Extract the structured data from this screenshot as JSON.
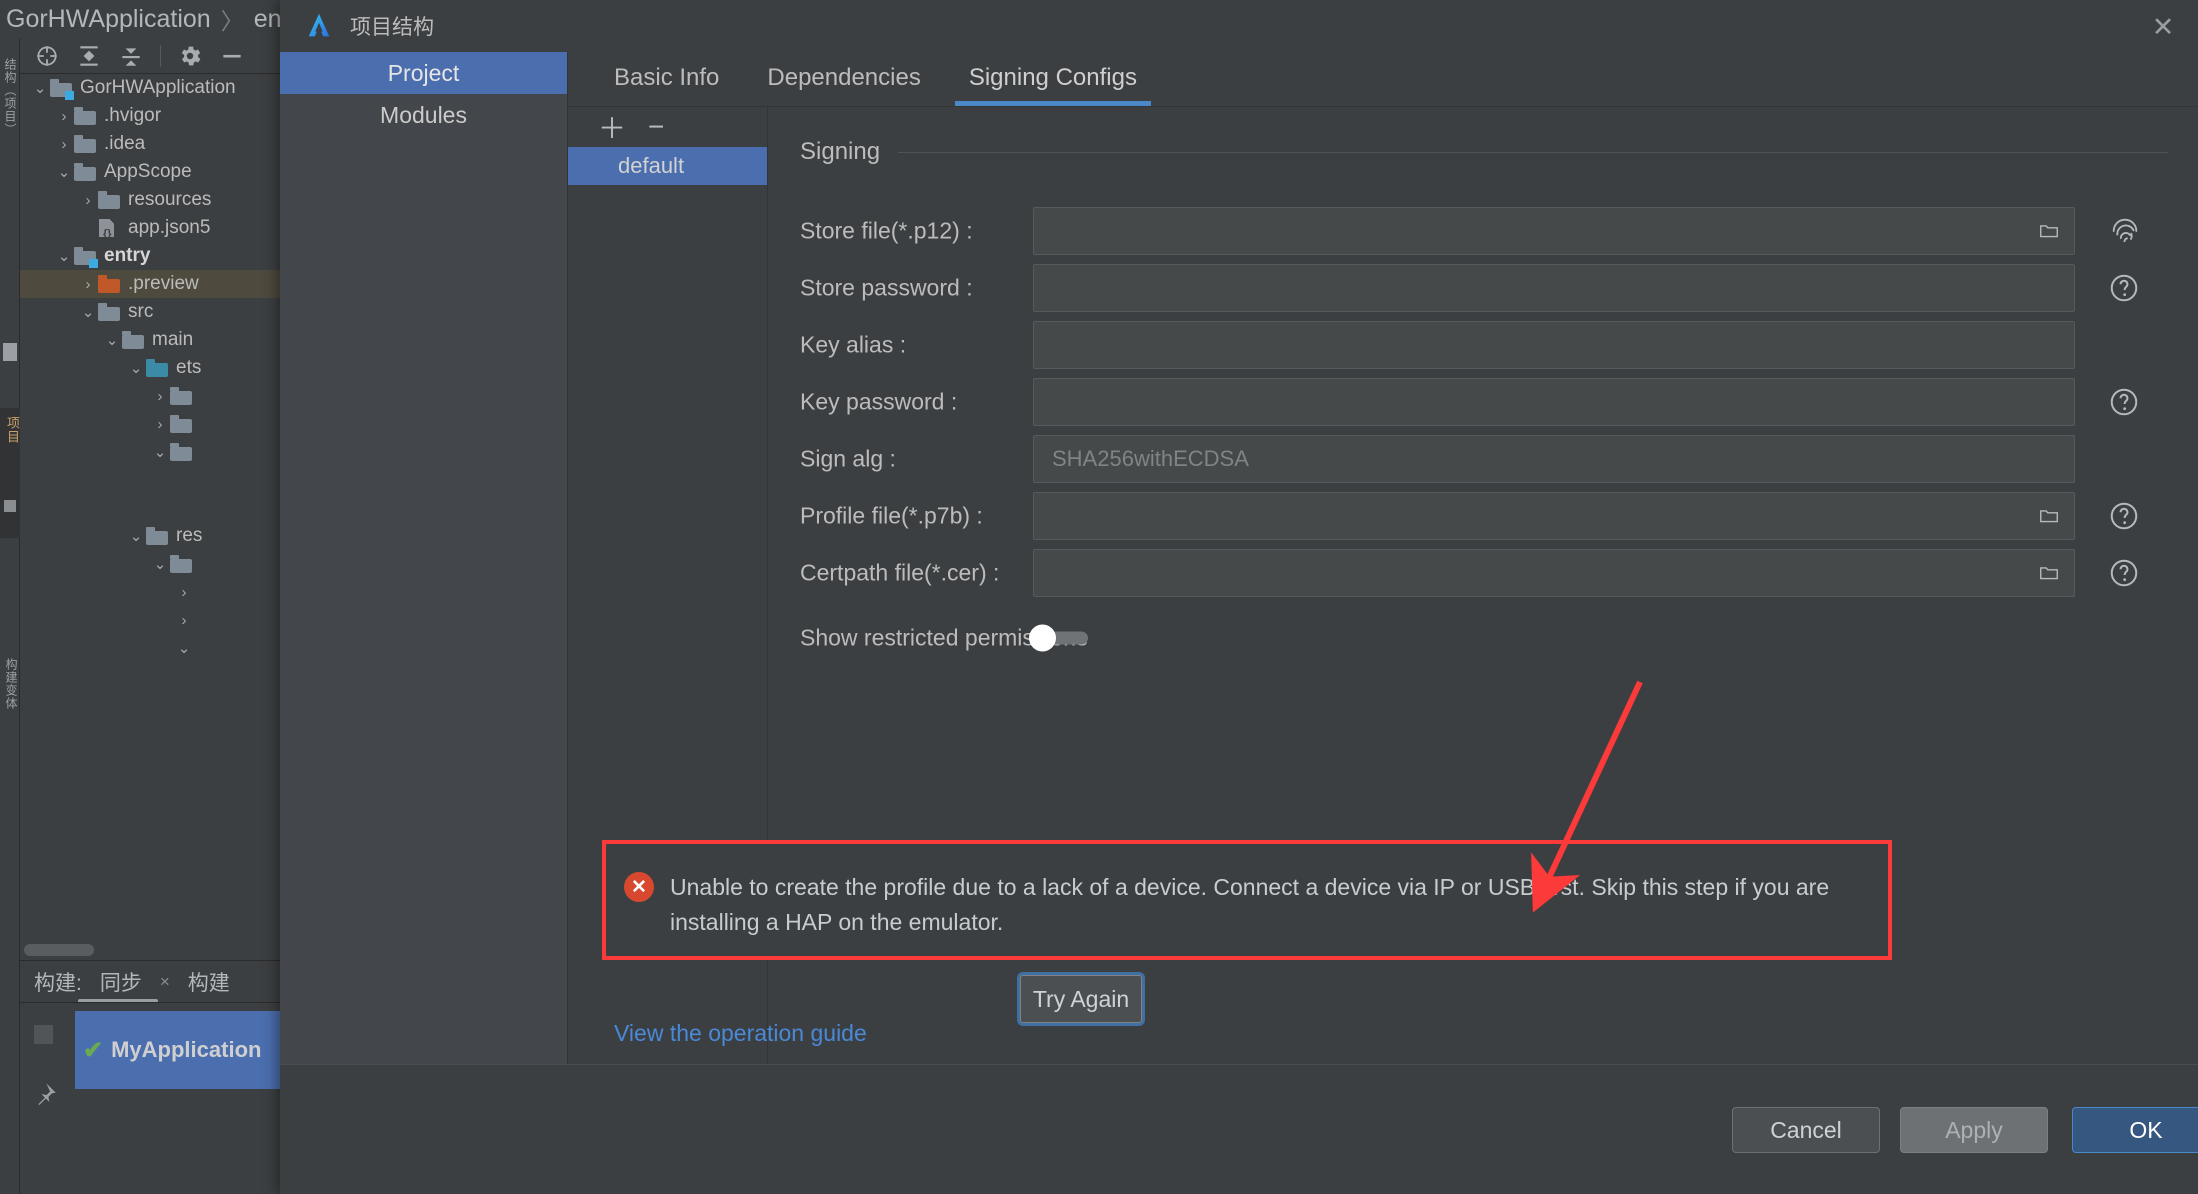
{
  "ide": {
    "breadcrumb": {
      "project": "GorHWApplication",
      "separator": "〉",
      "module": "en"
    },
    "toolbar": {
      "icons": [
        "locate-target-icon",
        "expand-all-icon",
        "collapse-all-icon",
        "gear-icon",
        "minimize-icon"
      ]
    },
    "rail": {
      "top_label": "结构（项目）",
      "mid_label": "项目",
      "bottom_label": "构建变体"
    },
    "tree": [
      {
        "label": "GorHWApplication",
        "twisty": "⌄",
        "icon": "module-folder-icon",
        "depth": 0,
        "bold": false,
        "selected": false
      },
      {
        "label": ".hvigor",
        "twisty": "›",
        "icon": "folder-icon",
        "depth": 1,
        "bold": false,
        "selected": false
      },
      {
        "label": ".idea",
        "twisty": "›",
        "icon": "folder-icon",
        "depth": 1,
        "bold": false,
        "selected": false
      },
      {
        "label": "AppScope",
        "twisty": "⌄",
        "icon": "folder-icon",
        "depth": 1,
        "bold": false,
        "selected": false
      },
      {
        "label": "resources",
        "twisty": "›",
        "icon": "folder-icon",
        "depth": 2,
        "bold": false,
        "selected": false
      },
      {
        "label": "app.json5",
        "twisty": "",
        "icon": "json-file-icon",
        "depth": 2,
        "bold": false,
        "selected": false
      },
      {
        "label": "entry",
        "twisty": "⌄",
        "icon": "module-folder-icon",
        "depth": 1,
        "bold": true,
        "selected": false
      },
      {
        "label": ".preview",
        "twisty": "›",
        "icon": "folder-orange-icon",
        "depth": 2,
        "bold": false,
        "selected": true
      },
      {
        "label": "src",
        "twisty": "⌄",
        "icon": "folder-icon",
        "depth": 2,
        "bold": false,
        "selected": false
      },
      {
        "label": "main",
        "twisty": "⌄",
        "icon": "folder-icon",
        "depth": 3,
        "bold": false,
        "selected": false
      },
      {
        "label": "ets",
        "twisty": "⌄",
        "icon": "folder-teal-icon",
        "depth": 4,
        "bold": false,
        "selected": false
      },
      {
        "label": "",
        "twisty": "›",
        "icon": "folder-icon",
        "depth": 5,
        "bold": false,
        "selected": false
      },
      {
        "label": "",
        "twisty": "›",
        "icon": "folder-icon",
        "depth": 5,
        "bold": false,
        "selected": false
      },
      {
        "label": "",
        "twisty": "⌄",
        "icon": "folder-icon",
        "depth": 5,
        "bold": false,
        "selected": false
      },
      {
        "label": "",
        "twisty": "",
        "icon": "",
        "depth": 5,
        "bold": false,
        "selected": false
      },
      {
        "label": "",
        "twisty": "",
        "icon": "",
        "depth": 5,
        "bold": false,
        "selected": false
      },
      {
        "label": "res",
        "twisty": "⌄",
        "icon": "folder-icon",
        "depth": 4,
        "bold": false,
        "selected": false
      },
      {
        "label": "",
        "twisty": "⌄",
        "icon": "folder-icon",
        "depth": 5,
        "bold": false,
        "selected": false
      },
      {
        "label": "",
        "twisty": "›",
        "icon": "",
        "depth": 6,
        "bold": false,
        "selected": false
      },
      {
        "label": "",
        "twisty": "›",
        "icon": "",
        "depth": 6,
        "bold": false,
        "selected": false
      },
      {
        "label": "",
        "twisty": "⌄",
        "icon": "",
        "depth": 6,
        "bold": false,
        "selected": false
      }
    ],
    "build": {
      "label": "构建:",
      "tab_sync": "同步",
      "tab_close": "×",
      "tab_build": "构建",
      "item_check": "✔",
      "item_label": "MyApplication"
    }
  },
  "dialog": {
    "title": "项目结构",
    "close_label": "✕",
    "nav": [
      {
        "label": "Project",
        "active": true
      },
      {
        "label": "Modules",
        "active": false
      }
    ],
    "tabs": [
      {
        "label": "Basic Info",
        "active": false
      },
      {
        "label": "Dependencies",
        "active": false
      },
      {
        "label": "Signing Configs",
        "active": true
      }
    ],
    "config_tools": {
      "add": "＋",
      "remove": "−"
    },
    "config_items": [
      {
        "label": "default",
        "selected": true
      }
    ],
    "section_title": "Signing",
    "fields": [
      {
        "label": "Store file(*.p12) :",
        "value": "",
        "placeholder": "",
        "browse": true,
        "help": "fingerprint-icon"
      },
      {
        "label": "Store password :",
        "value": "",
        "placeholder": "",
        "browse": false,
        "help": "help-icon"
      },
      {
        "label": "Key alias :",
        "value": "",
        "placeholder": "",
        "browse": false,
        "help": ""
      },
      {
        "label": "Key password :",
        "value": "",
        "placeholder": "",
        "browse": false,
        "help": "help-icon"
      },
      {
        "label": "Sign alg :",
        "value": "",
        "placeholder": "SHA256withECDSA",
        "browse": false,
        "help": ""
      },
      {
        "label": "Profile file(*.p7b) :",
        "value": "",
        "placeholder": "",
        "browse": true,
        "help": "help-icon"
      },
      {
        "label": "Certpath file(*.cer) :",
        "value": "",
        "placeholder": "",
        "browse": true,
        "help": "help-icon"
      }
    ],
    "toggle": {
      "label": "Show restricted permissions",
      "on": false
    },
    "error": {
      "icon": "error-icon",
      "message": "Unable to create the profile due to a lack of a device. Connect a device via IP or USB first. Skip this step if you are installing a HAP on the emulator.",
      "border_color": "#fc3a3a"
    },
    "try_again_label": "Try Again",
    "guide_link": "View the operation guide",
    "footer_buttons": [
      {
        "label": "Cancel",
        "style": "cancel"
      },
      {
        "label": "Apply",
        "style": "apply"
      },
      {
        "label": "OK",
        "style": "ok"
      }
    ]
  },
  "annotation": {
    "arrow_color": "#fc3a3a",
    "highlight_color": "#fc3a3a"
  }
}
